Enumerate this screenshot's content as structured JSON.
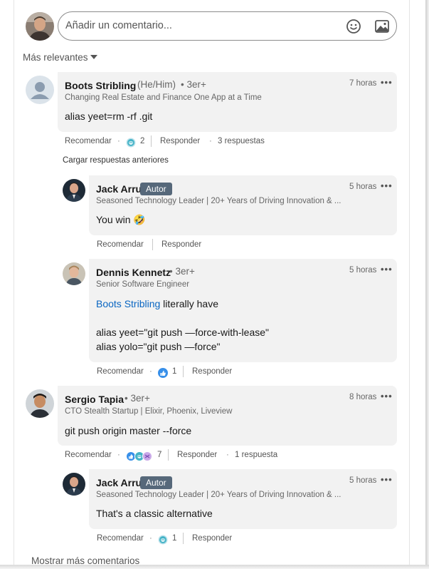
{
  "composer": {
    "placeholder": "Añadir un comentario...",
    "emoji_icon": "emoji-icon",
    "image_icon": "image-icon"
  },
  "sort": {
    "label": "Más relevantes"
  },
  "comments": [
    {
      "author": "Boots Stribling",
      "pronouns": "(He/Him)",
      "degree": "• 3er+",
      "headline": "Changing Real Estate and Finance One App at a Time",
      "time": "7 horas",
      "body": "alias yeet=rm -rf .git",
      "like": "Recomendar",
      "reply": "Responder",
      "reaction_count": "2",
      "replies_count": "3 respuestas"
    },
    {
      "author": "Sergio Tapia",
      "degree": "• 3er+",
      "headline": "CTO Stealth Startup | Elixir, Phoenix, Liveview",
      "time": "8 horas",
      "body": "git push origin master --force",
      "like": "Recomendar",
      "reply": "Responder",
      "reaction_count": "7",
      "replies_count": "1 respuesta"
    }
  ],
  "load_previous": "Cargar respuestas anteriores",
  "replies": [
    {
      "author": "Jack Arru",
      "badge": "Autor",
      "headline": "Seasoned Technology Leader | 20+ Years of Driving Innovation & ...",
      "time": "5 horas",
      "body": "You win 🤣",
      "like": "Recomendar",
      "reply": "Responder"
    },
    {
      "author": "Dennis Kennetz",
      "degree": "• 3er+",
      "headline": "Senior Software Engineer",
      "time": "5 horas",
      "mention": "Boots Stribling",
      "body_after_mention": " literally have",
      "line2": "alias yeet=\"git push —force-with-lease\"",
      "line3": "alias yolo=\"git push —force\"",
      "like": "Recomendar",
      "reply": "Responder",
      "reaction_count": "1"
    },
    {
      "author": "Jack Arru",
      "badge": "Autor",
      "headline": "Seasoned Technology Leader | 20+ Years of Driving Innovation & ...",
      "time": "5 horas",
      "body": "That's a classic alternative",
      "like": "Recomendar",
      "reply": "Responder",
      "reaction_count": "1"
    }
  ],
  "more_options": "•••",
  "separator_dot": "·",
  "show_more": "Mostrar más comentarios",
  "colors": {
    "accent": "#0a66c2",
    "badge": "#56687a",
    "bubble": "#f2f2f2"
  }
}
